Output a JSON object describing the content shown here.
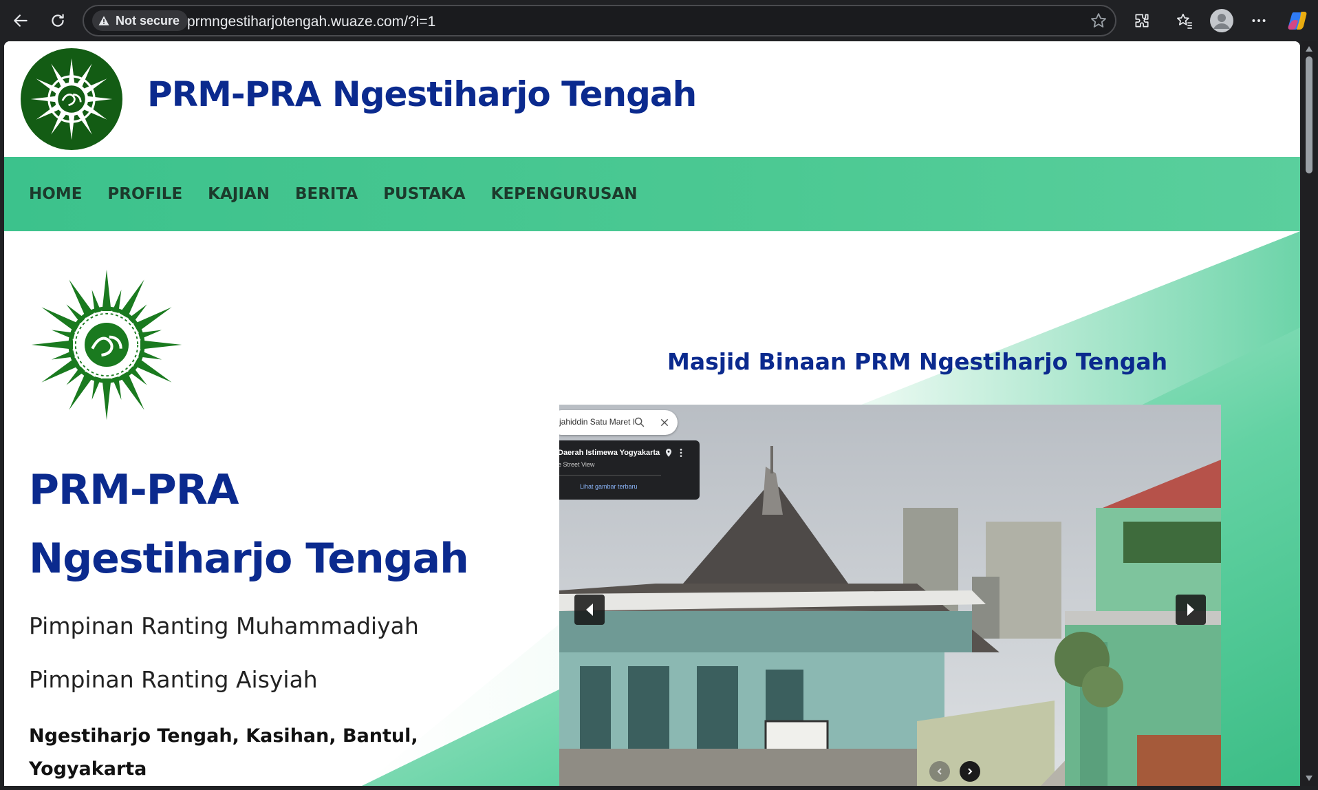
{
  "browser": {
    "security_label": "Not secure",
    "url": "prmngestiharjotengah.wuaze.com/?i=1"
  },
  "site": {
    "title": "PRM-PRA Ngestiharjo Tengah",
    "nav": [
      "HOME",
      "PROFILE",
      "KAJIAN",
      "BERITA",
      "PUSTAKA",
      "KEPENGURUSAN"
    ]
  },
  "hero": {
    "heading_line1": "PRM-PRA",
    "heading_line2": "Ngestiharjo Tengah",
    "subtitle1": "Pimpinan Ranting Muhammadiyah",
    "subtitle2": "Pimpinan Ranting Aisyiah",
    "address_line1": "Ngestiharjo Tengah, Kasihan, Bantul,",
    "address_line2": "Yogyakarta"
  },
  "masjid": {
    "title": "Masjid Binaan PRM Ngestiharjo Tengah",
    "streetview": {
      "search_text": "jahiddin Satu Maret I",
      "location": "Daerah Istimewa Yogyakarta",
      "source": "e Street View",
      "latest_link": "Lihat gambar terbaru"
    }
  },
  "colors": {
    "brand_blue": "#0b2a8e",
    "nav_green": "#4cc993",
    "logo_green": "#135c14"
  }
}
